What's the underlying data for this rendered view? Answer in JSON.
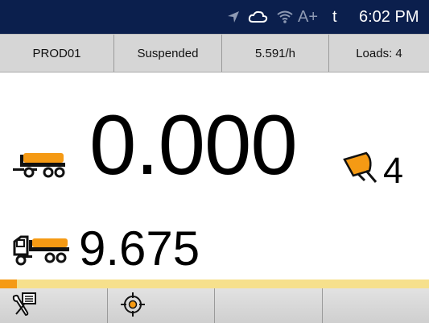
{
  "status": {
    "icons": [
      "location-arrow-icon",
      "cloud-icon",
      "wifi-icon"
    ],
    "signal_label": "A+",
    "t_label": "t",
    "time": "6:02 PM"
  },
  "info": {
    "product": "PROD01",
    "state": "Suspended",
    "rate": "5.591/h",
    "loads": "Loads: 4"
  },
  "main": {
    "current_weight": "0.000",
    "total_weight": "9.675",
    "bucket_count": "4"
  },
  "progress": {
    "fraction": 0.04
  },
  "colors": {
    "accent": "#f59a14",
    "header": "#0b1f4d",
    "bar_track": "#f6e08c"
  },
  "bottom": {
    "buttons": [
      "settings-tools-icon",
      "target-crosshair-icon",
      "blank",
      "blank"
    ]
  }
}
